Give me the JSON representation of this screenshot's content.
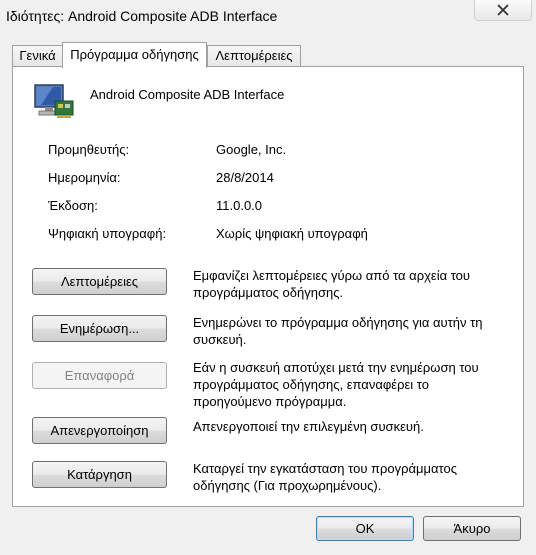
{
  "window": {
    "title": "Ιδιότητες: Android Composite ADB Interface",
    "close_icon": "close-icon"
  },
  "tabs": [
    {
      "label": "Γενικά",
      "active": false
    },
    {
      "label": "Πρόγραμμα οδήγησης",
      "active": true
    },
    {
      "label": "Λεπτομέρειες",
      "active": false
    }
  ],
  "device": {
    "icon": "device-monitor-icon",
    "name": "Android Composite ADB Interface"
  },
  "properties": [
    {
      "label": "Προμηθευτής:",
      "value": "Google, Inc."
    },
    {
      "label": "Ημερομηνία:",
      "value": "28/8/2014"
    },
    {
      "label": "Έκδοση:",
      "value": "11.0.0.0"
    },
    {
      "label": "Ψηφιακή υπογραφή:",
      "value": "Χωρίς ψηφιακή υπογραφή"
    }
  ],
  "actions": [
    {
      "label": "Λεπτομέρειες",
      "enabled": true,
      "description": "Εμφανίζει λεπτομέρειες γύρω από τα αρχεία του προγράμματος οδήγησης."
    },
    {
      "label": "Ενημέρωση...",
      "enabled": true,
      "description": "Ενημερώνει το πρόγραμμα οδήγησης για αυτήν τη συσκευή."
    },
    {
      "label": "Επαναφορά",
      "enabled": false,
      "description": "Εάν η συσκευή αποτύχει μετά την ενημέρωση του προγράμματος οδήγησης, επαναφέρει το προηγούμενο πρόγραμμα."
    },
    {
      "label": "Απενεργοποίηση",
      "enabled": true,
      "description": "Απενεργοποιεί την επιλεγμένη συσκευή."
    },
    {
      "label": "Κατάργηση",
      "enabled": true,
      "description": "Καταργεί την εγκατάσταση του προγράμματος οδήγησης (Για προχωρημένους)."
    }
  ],
  "footer": {
    "ok_label": "OK",
    "cancel_label": "Άκυρο"
  }
}
